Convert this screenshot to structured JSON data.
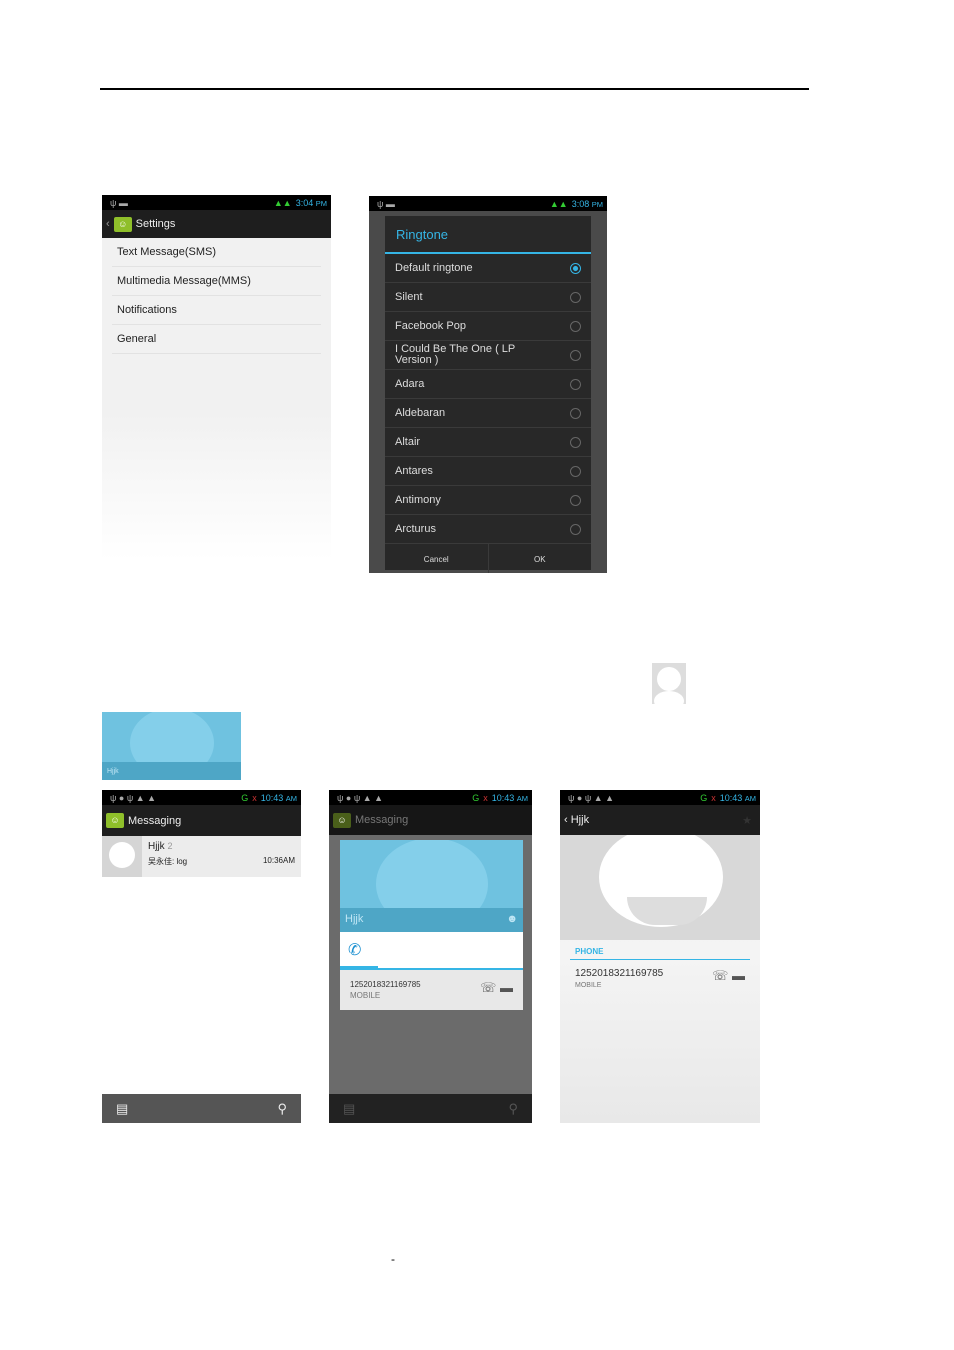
{
  "settings_screen": {
    "time": "3:04",
    "ampm": "PM",
    "title": "Settings",
    "items": [
      "Text Message(SMS)",
      "Multimedia Message(MMS)",
      "Notifications",
      "General"
    ]
  },
  "ringtone_dialog": {
    "time": "3:08",
    "ampm": "PM",
    "title": "Ringtone",
    "options": [
      "Default ringtone",
      "Silent",
      "Facebook Pop",
      "I Could Be The One ( LP Version )",
      "Adara",
      "Aldebaran",
      "Altair",
      "Antares",
      "Antimony",
      "Arcturus"
    ],
    "selected_index": 0,
    "cancel": "Cancel",
    "ok": "OK"
  },
  "thumb": {
    "name": "Hjjk"
  },
  "messaging_screen": {
    "time": "10:43",
    "ampm": "AM",
    "net": "G",
    "title": "Messaging",
    "thread": {
      "name": "Hjjk",
      "count": "2",
      "snippet": "吴永佳: log",
      "time": "10:36AM"
    }
  },
  "quick_contact": {
    "time": "10:43",
    "ampm": "AM",
    "title": "Messaging",
    "name": "Hjjk",
    "number": "1252018321169785",
    "type": "MOBILE"
  },
  "contact_screen": {
    "time": "10:43",
    "ampm": "AM",
    "name": "Hjjk",
    "section": "PHONE",
    "number": "1252018321169785",
    "type": "MOBILE"
  },
  "footer_mark": "-",
  "colors": {
    "accent": "#35b5e5",
    "app_green": "#8fbf2a"
  }
}
